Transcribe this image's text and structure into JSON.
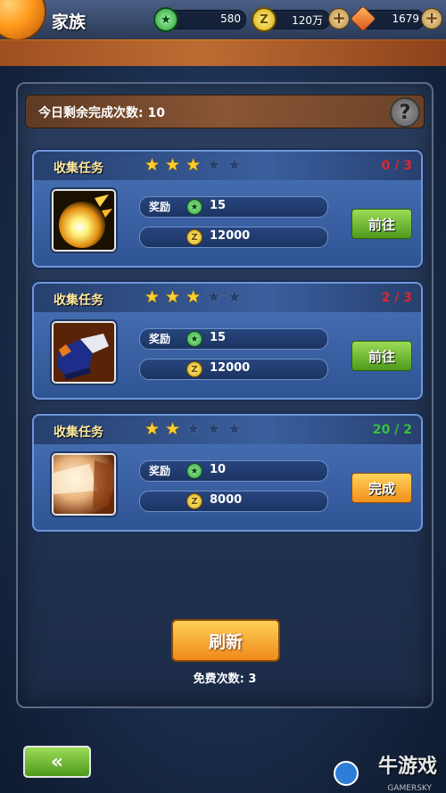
{
  "header": {
    "title": "家族",
    "resources": [
      {
        "icon": "green-token-icon",
        "value": "580"
      },
      {
        "icon": "gold-coin-icon",
        "value": "120万"
      },
      {
        "icon": "orange-crystal-icon",
        "value": "1679"
      }
    ]
  },
  "panel": {
    "remaining_label": "今日剩余完成次数: 10",
    "tasks": [
      {
        "title": "收集任务",
        "stars": 3,
        "max_stars": 5,
        "progress": "0 / 3",
        "progress_color": "#e0262a",
        "reward_label": "奖励",
        "token_reward": "15",
        "coin_reward": "12000",
        "action": "前往",
        "action_style": "green",
        "item_icon": "energy-blast-icon"
      },
      {
        "title": "收集任务",
        "stars": 3,
        "max_stars": 5,
        "progress": "2 / 3",
        "progress_color": "#e0262a",
        "reward_label": "奖励",
        "token_reward": "15",
        "coin_reward": "12000",
        "action": "前往",
        "action_style": "green",
        "item_icon": "boot-icon"
      },
      {
        "title": "收集任务",
        "stars": 2,
        "max_stars": 5,
        "progress": "20 / 2",
        "progress_color": "#36c23a",
        "reward_label": "奖励",
        "token_reward": "10",
        "coin_reward": "8000",
        "action": "完成",
        "action_style": "orange",
        "item_icon": "glowing-fist-icon"
      }
    ],
    "refresh_label": "刷新",
    "free_count": "免费次数: 3"
  },
  "footer": {
    "back_icon": "double-chevron-left-icon",
    "watermark": "牛游戏",
    "watermark_sub": "GAMERSKY"
  }
}
